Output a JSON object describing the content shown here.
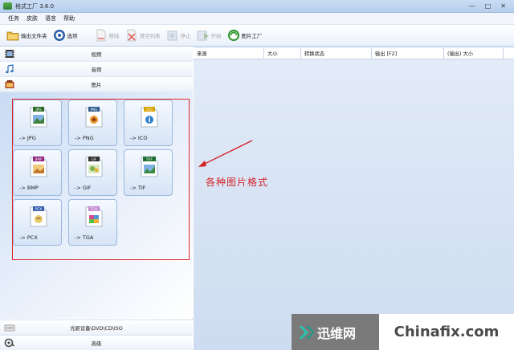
{
  "window": {
    "title": "格式工厂 3.6.0",
    "controls": [
      "—",
      "□",
      "✕"
    ]
  },
  "menu": [
    "任务",
    "皮肤",
    "语言",
    "帮助"
  ],
  "toolbar": [
    {
      "label": "输出文件夹",
      "icon": "folder-icon",
      "enabled": true
    },
    {
      "label": "选项",
      "icon": "options-icon",
      "enabled": true
    },
    {
      "label": "移除",
      "icon": "remove-icon",
      "enabled": false
    },
    {
      "label": "清空列表",
      "icon": "clear-list-icon",
      "enabled": false
    },
    {
      "label": "停止",
      "icon": "stop-icon",
      "enabled": false
    },
    {
      "label": "开始",
      "icon": "start-icon",
      "enabled": false
    },
    {
      "label": "图片工厂",
      "icon": "picture-factory-icon",
      "enabled": true
    }
  ],
  "categories": [
    {
      "label": "视频",
      "icon": "film-icon"
    },
    {
      "label": "音频",
      "icon": "music-note-icon"
    },
    {
      "label": "图片",
      "icon": "picture-icon"
    }
  ],
  "formats": [
    {
      "badge": "JPG",
      "label": "-> JPG",
      "color": "#2f6c2b"
    },
    {
      "badge": "PNG",
      "label": "-> PNG",
      "color": "#2f5a8c"
    },
    {
      "badge": "ICO",
      "label": "-> ICO",
      "color": "#d9a400"
    },
    {
      "badge": "BMP",
      "label": "-> BMP",
      "color": "#8b1e7c"
    },
    {
      "badge": "GIF",
      "label": "-> GIF",
      "color": "#2f2f2f"
    },
    {
      "badge": "TIFF",
      "label": "-> TIF",
      "color": "#1c6e2e"
    },
    {
      "badge": "PCX",
      "label": "-> PCX",
      "color": "#3a5fb0"
    },
    {
      "badge": "TGA",
      "label": "-> TGA",
      "color": "#c58bd0"
    }
  ],
  "bottom": [
    {
      "label": "光驱设备\\DVD\\CD\\ISO",
      "icon": "disc-drive-icon"
    },
    {
      "label": "高级",
      "icon": "advanced-tools-icon"
    }
  ],
  "table_headers": [
    "来源",
    "大小",
    "转换状态",
    "输出 [F2]",
    "(输出) 大小"
  ],
  "annotation": "各种图片格式",
  "watermark": {
    "brand": "迅维网",
    "site": "Chinafix.com"
  },
  "colors": {
    "accent_red": "#e0252b",
    "selection_blue": "#cddcf0"
  }
}
